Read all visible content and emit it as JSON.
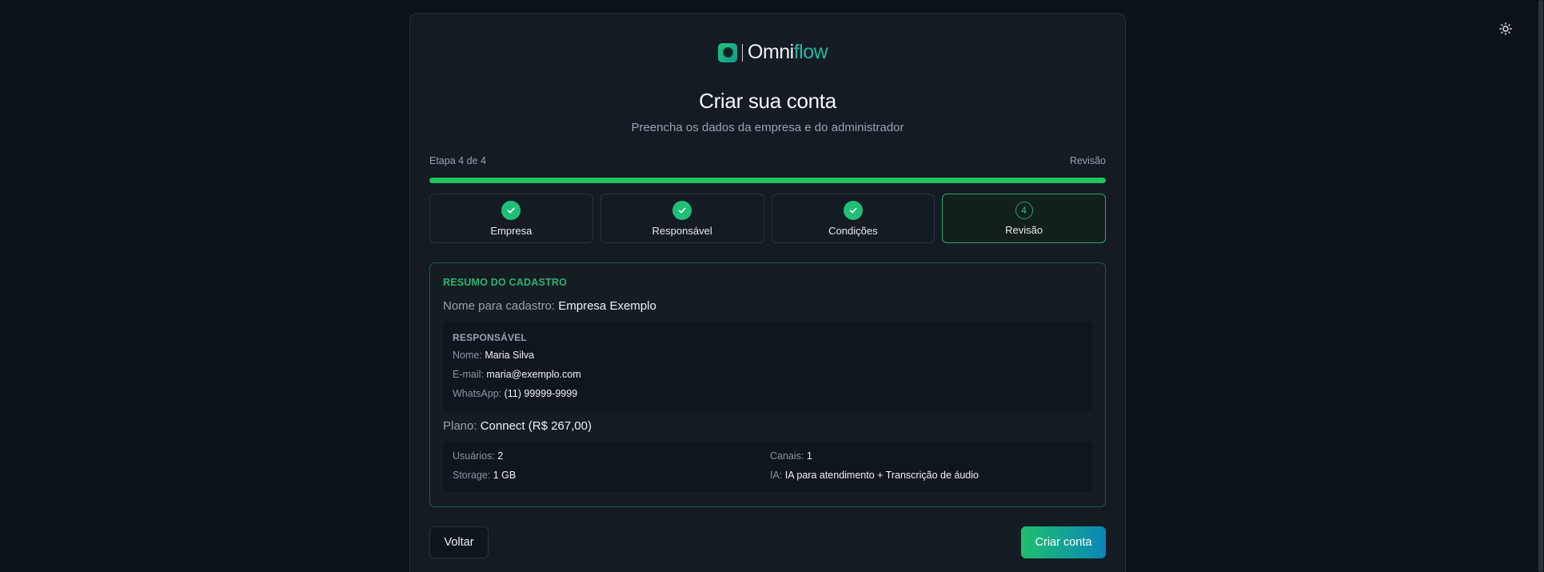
{
  "brand": {
    "name_part1": "Omni",
    "name_part2": "flow"
  },
  "header": {
    "title": "Criar sua conta",
    "subtitle": "Preencha os dados da empresa e do administrador"
  },
  "progress": {
    "step_text": "Etapa 4 de 4",
    "current_label": "Revisão",
    "percent": 100
  },
  "steps": [
    {
      "label": "Empresa",
      "status": "done"
    },
    {
      "label": "Responsável",
      "status": "done"
    },
    {
      "label": "Condições",
      "status": "done"
    },
    {
      "label": "Revisão",
      "status": "active",
      "number": "4"
    }
  ],
  "summary": {
    "title": "RESUMO DO CADASTRO",
    "company_label": "Nome para cadastro:",
    "company_value": "Empresa Exemplo",
    "responsible": {
      "title": "RESPONSÁVEL",
      "name_label": "Nome:",
      "name_value": "Maria Silva",
      "email_label": "E-mail:",
      "email_value": "maria@exemplo.com",
      "whatsapp_label": "WhatsApp:",
      "whatsapp_value": "(11) 99999-9999"
    },
    "plan_label": "Plano:",
    "plan_value": "Connect (R$ 267,00)",
    "plan_details": {
      "users_label": "Usuários:",
      "users_value": "2",
      "channels_label": "Canais:",
      "channels_value": "1",
      "storage_label": "Storage:",
      "storage_value": "1 GB",
      "ai_label": "IA:",
      "ai_value": "IA para atendimento + Transcrição de áudio"
    }
  },
  "actions": {
    "back_label": "Voltar",
    "create_label": "Criar conta"
  },
  "icons": {
    "theme_toggle": "sun-icon",
    "step_done": "check-icon"
  },
  "colors": {
    "accent": "#22c55e",
    "background": "#0c1219",
    "card": "#151b23"
  }
}
